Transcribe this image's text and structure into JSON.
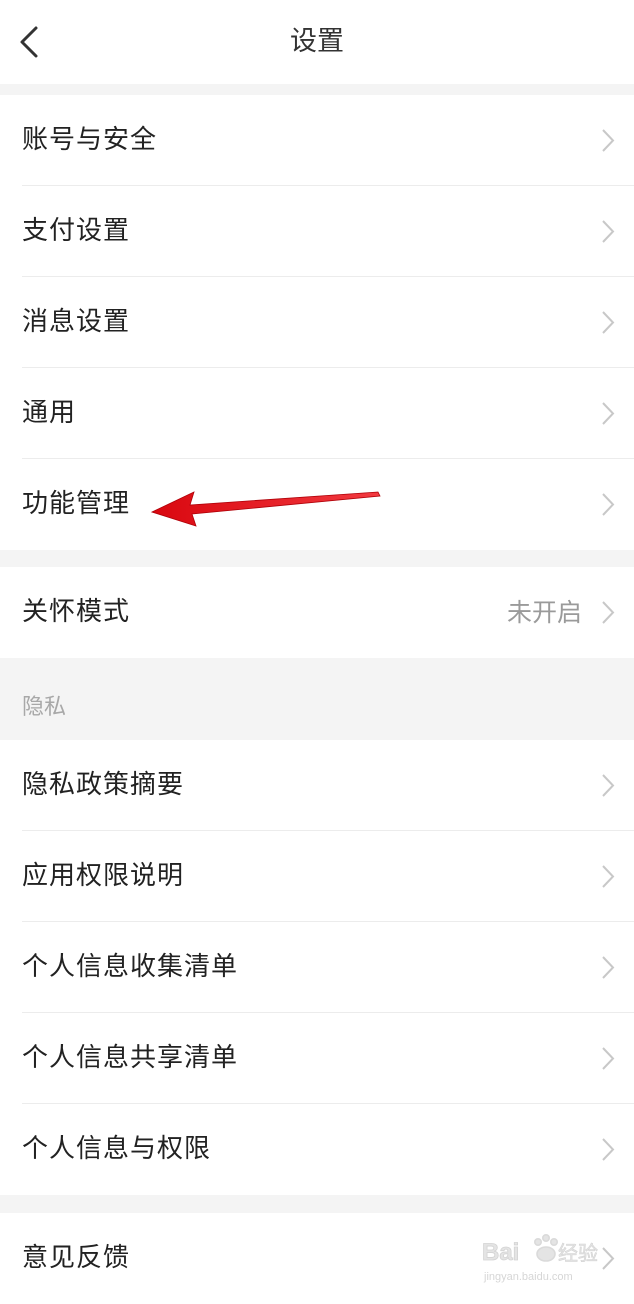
{
  "header": {
    "title": "设置",
    "back_icon": "chevron-left-icon"
  },
  "groups": [
    {
      "items": [
        {
          "label": "账号与安全"
        },
        {
          "label": "支付设置"
        },
        {
          "label": "消息设置"
        },
        {
          "label": "通用"
        },
        {
          "label": "功能管理"
        }
      ]
    },
    {
      "items": [
        {
          "label": "关怀模式",
          "value": "未开启"
        }
      ]
    },
    {
      "section_title": "隐私",
      "items": [
        {
          "label": "隐私政策摘要"
        },
        {
          "label": "应用权限说明"
        },
        {
          "label": "个人信息收集清单"
        },
        {
          "label": "个人信息共享清单"
        },
        {
          "label": "个人信息与权限"
        }
      ]
    },
    {
      "items": [
        {
          "label": "意见反馈"
        }
      ]
    }
  ],
  "annotation": {
    "arrow_color": "#e8141b",
    "points_to": "功能管理"
  },
  "watermark": {
    "brand": "Baidu经验",
    "url": "jingyan.baidu.com"
  },
  "colors": {
    "background": "#f4f4f4",
    "row_background": "#ffffff",
    "label_text": "#222222",
    "secondary_text": "#9a9a9a",
    "chevron": "#c8c8c8"
  }
}
